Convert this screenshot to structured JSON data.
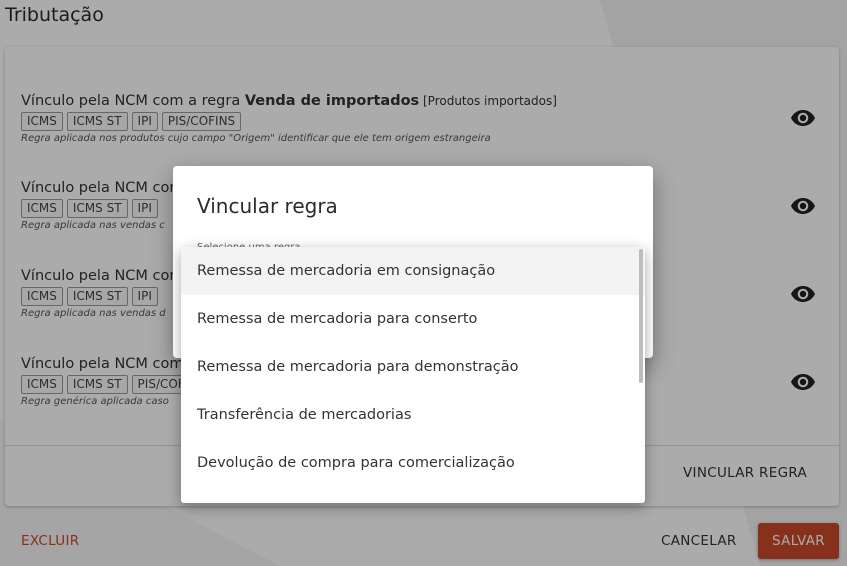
{
  "section": {
    "title": "Tributação"
  },
  "rules": [
    {
      "prefix": "Vínculo pela NCM com a regra ",
      "name": "Venda de importados",
      "note": " [Produtos importados]",
      "tags": [
        "ICMS",
        "ICMS ST",
        "IPI",
        "PIS/COFINS"
      ],
      "description": "Regra aplicada nos produtos cujo campo \"Origem\" identificar que ele tem origem estrangeira"
    },
    {
      "prefix": "Vínculo pela NCM com a regra",
      "name": "",
      "note": "",
      "tags": [
        "ICMS",
        "ICMS ST",
        "IPI"
      ],
      "description": "Regra aplicada nas vendas c"
    },
    {
      "prefix": "Vínculo pela NCM com a regra",
      "name": "",
      "note": "",
      "tags": [
        "ICMS",
        "ICMS ST",
        "IPI"
      ],
      "description": "Regra aplicada nas vendas d"
    },
    {
      "prefix": "Vínculo pela NCM com a regra",
      "name": "",
      "note": "",
      "tags": [
        "ICMS",
        "ICMS ST",
        "PIS/COFINS"
      ],
      "description": "Regra genérica aplicada caso"
    }
  ],
  "buttons": {
    "vincular_regra": "VINCULAR REGRA",
    "excluir": "EXCLUIR",
    "cancelar": "CANCELAR",
    "salvar": "SALVAR"
  },
  "dialog": {
    "title": "Vincular regra",
    "select_label": "Selecione uma regra"
  },
  "menu": {
    "items": [
      "Remessa de mercadoria em consignação",
      "Remessa de mercadoria para conserto",
      "Remessa de mercadoria para demonstração",
      "Transferência de mercadorias",
      "Devolução de compra para comercialização"
    ],
    "active_index": 0
  },
  "colors": {
    "accent": "#c9492a",
    "backdrop": "rgba(0,0,0,0.33)"
  },
  "icons": {
    "view": "eye-icon"
  }
}
